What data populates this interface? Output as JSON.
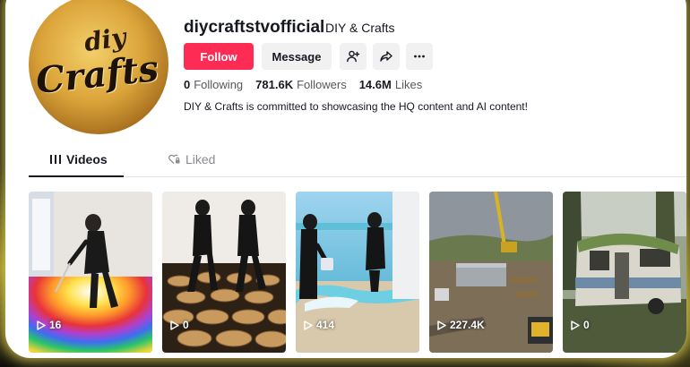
{
  "profile": {
    "username": "diycraftstvofficial",
    "nickname": "DIY & Crafts",
    "avatar_text_top": "diy",
    "avatar_text_main": "Crafts",
    "bio": "DIY & Crafts is committed to showcasing the HQ content and AI content!"
  },
  "actions": {
    "follow_label": "Follow",
    "message_label": "Message",
    "add_friend_icon": "add-user-icon",
    "share_icon": "share-icon",
    "more_icon": "more-icon"
  },
  "stats": {
    "following_count": "0",
    "following_label": "Following",
    "followers_count": "781.6K",
    "followers_label": "Followers",
    "likes_count": "14.6M",
    "likes_label": "Likes"
  },
  "tabs": [
    {
      "label": "Videos",
      "icon": "grid-icon",
      "active": true
    },
    {
      "label": "Liked",
      "icon": "heart-lock-icon",
      "active": false
    }
  ],
  "videos": [
    {
      "views": "16"
    },
    {
      "views": "0"
    },
    {
      "views": "414"
    },
    {
      "views": "227.4K"
    },
    {
      "views": "0"
    }
  ],
  "colors": {
    "accent": "#fe2c55",
    "text": "#161823",
    "muted": "#8a8b91",
    "button_bg": "#f1f1f2"
  }
}
